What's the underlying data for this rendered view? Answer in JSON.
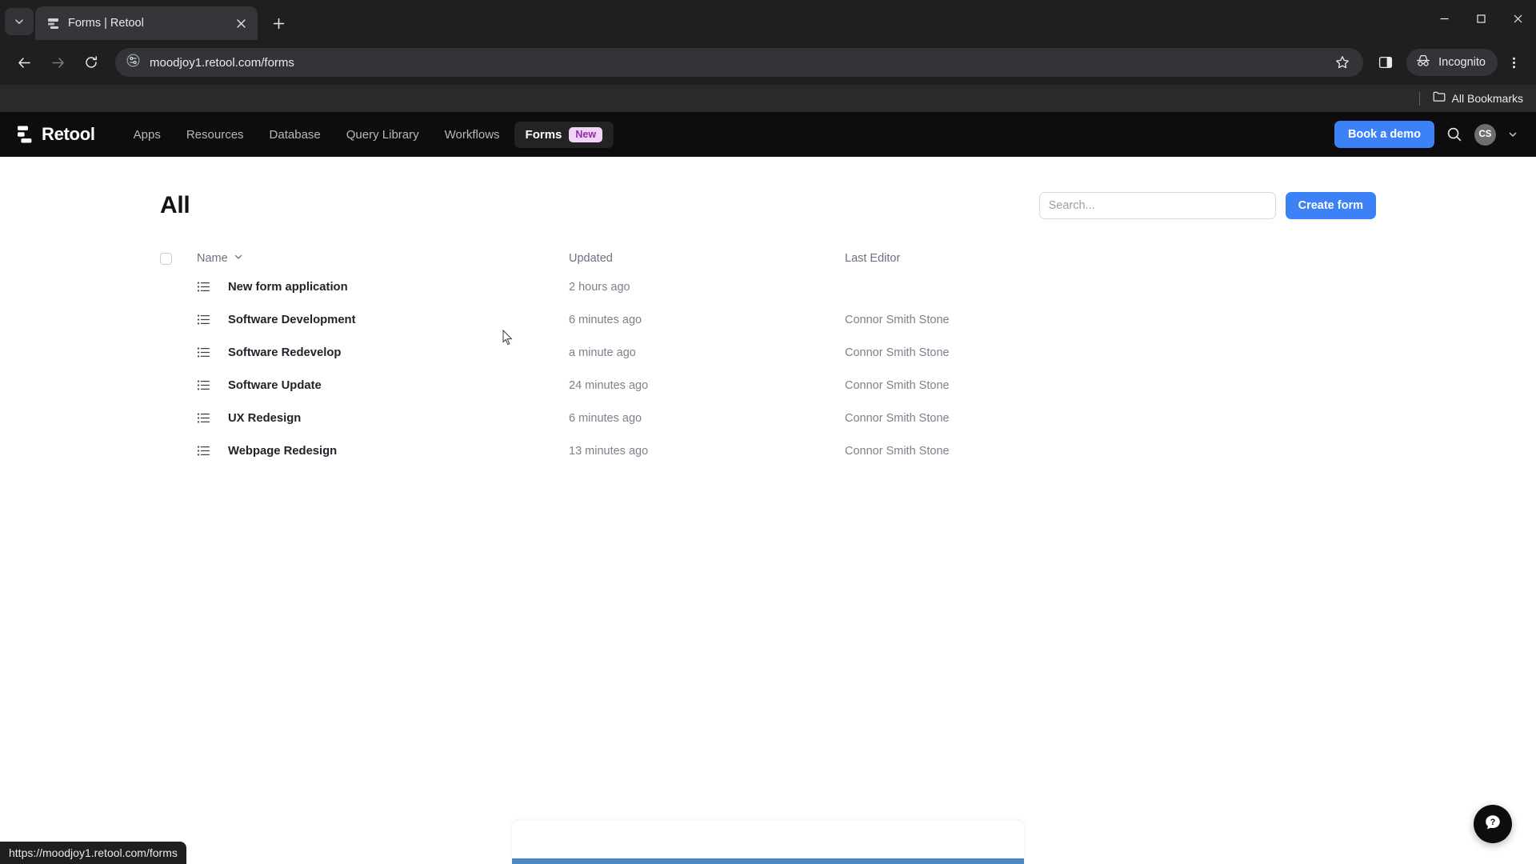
{
  "browser": {
    "tab": {
      "title": "Forms | Retool",
      "favicon_icon": "retool-favicon"
    },
    "tab_search_icon": "chevron-down-icon",
    "new_tab_icon": "plus-icon",
    "window_controls": {
      "minimize": "minimize-icon",
      "maximize": "maximize-icon",
      "close": "close-icon"
    },
    "nav": {
      "back_icon": "back-arrow-icon",
      "forward_icon": "forward-arrow-icon",
      "reload_icon": "reload-icon"
    },
    "omnibox": {
      "site_info_icon": "site-settings-icon",
      "url": "moodjoy1.retool.com/forms",
      "bookmark_icon": "star-icon",
      "sidepanel_icon": "side-panel-icon"
    },
    "incognito": {
      "icon": "incognito-icon",
      "label": "Incognito"
    },
    "menu_icon": "three-dot-menu-icon",
    "bookmarks_bar": {
      "folder_icon": "folder-icon",
      "label": "All Bookmarks"
    },
    "status_bubble": "https://moodjoy1.retool.com/forms"
  },
  "app": {
    "nav": {
      "logo_text": "Retool",
      "links": [
        {
          "label": "Apps",
          "active": false
        },
        {
          "label": "Resources",
          "active": false
        },
        {
          "label": "Database",
          "active": false
        },
        {
          "label": "Query Library",
          "active": false
        },
        {
          "label": "Workflows",
          "active": false
        },
        {
          "label": "Forms",
          "active": true,
          "badge": "New"
        }
      ],
      "demo_button": "Book a demo",
      "search_icon": "search-icon",
      "avatar_initials": "CS",
      "avatar_caret_icon": "chevron-down-icon"
    },
    "header": {
      "title": "All",
      "search_placeholder": "Search...",
      "search_value": "",
      "create_button": "Create form"
    },
    "table": {
      "columns": {
        "name": "Name",
        "name_sort_icon": "chevron-down-icon",
        "updated": "Updated",
        "editor": "Last Editor"
      },
      "select_all_checked": false,
      "rows": [
        {
          "icon": "list-icon",
          "name": "New form application",
          "updated": "2 hours ago",
          "editor": ""
        },
        {
          "icon": "list-icon",
          "name": "Software Development",
          "updated": "6 minutes ago",
          "editor": "Connor Smith Stone"
        },
        {
          "icon": "list-icon",
          "name": "Software Redevelop",
          "updated": "a minute ago",
          "editor": "Connor Smith Stone"
        },
        {
          "icon": "list-icon",
          "name": "Software Update",
          "updated": "24 minutes ago",
          "editor": "Connor Smith Stone"
        },
        {
          "icon": "list-icon",
          "name": "UX Redesign",
          "updated": "6 minutes ago",
          "editor": "Connor Smith Stone"
        },
        {
          "icon": "list-icon",
          "name": "Webpage Redesign",
          "updated": "13 minutes ago",
          "editor": "Connor Smith Stone"
        }
      ]
    },
    "help_button_icon": "help-question-icon"
  },
  "colors": {
    "accent_blue": "#3c82f6",
    "nav_dark": "#0d0d0d",
    "badge_bg": "#f3d2f7",
    "badge_fg": "#8b2fa5",
    "card_accent": "#4a87c4"
  }
}
